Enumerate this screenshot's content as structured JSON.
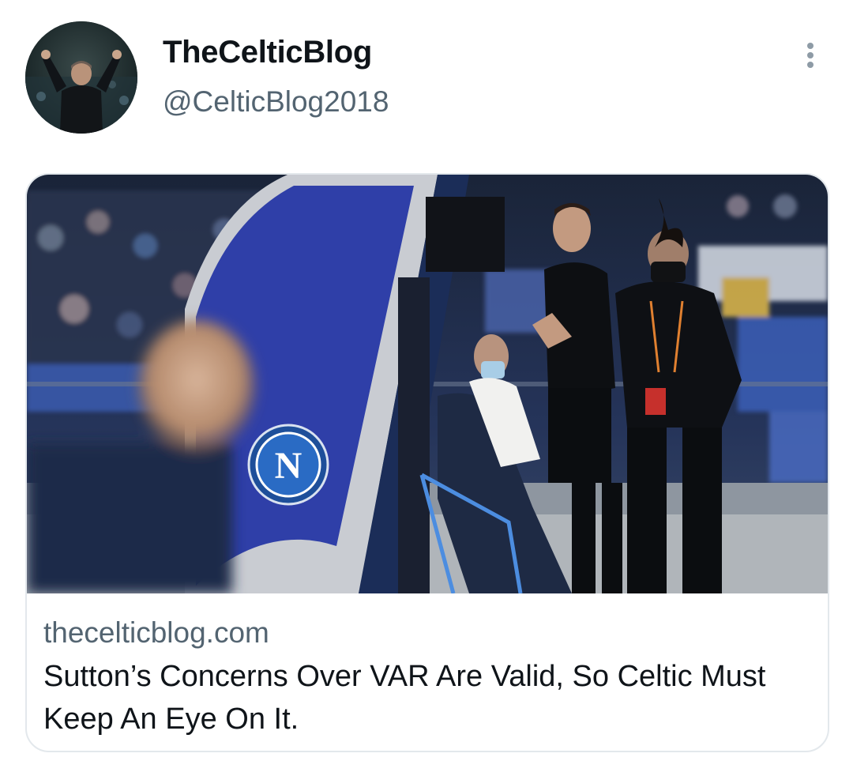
{
  "tweet": {
    "display_name": "TheCelticBlog",
    "handle": "@CelticBlog2018",
    "avatar_icon": "profile-photo-manager-celebrating",
    "more_icon": "more-vertical-icon"
  },
  "card": {
    "image_icon": "photo-referee-var-monitor",
    "image_badge_letter": "N",
    "domain": "thecelticblog.com",
    "title": "Sutton’s Concerns Over VAR Are Valid, So Celtic Must Keep An Eye On It."
  },
  "colors": {
    "text_primary": "#0f1419",
    "text_secondary": "#536471",
    "border": "#e3e8ec",
    "napoli_blue": "#2f3fa8"
  }
}
